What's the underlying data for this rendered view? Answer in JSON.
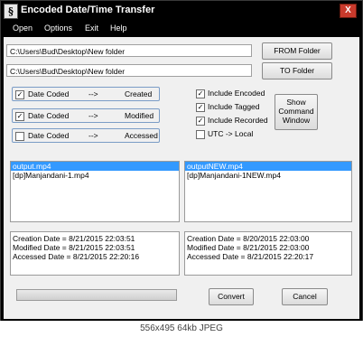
{
  "window": {
    "title": "Encoded Date/Time Transfer",
    "app_icon_glyph": "§",
    "close_glyph": "X"
  },
  "menu": [
    "Open",
    "Options",
    "Exit",
    "Help"
  ],
  "paths": {
    "from_folder": "C:\\Users\\Bud\\Desktop\\New folder",
    "to_folder": "C:\\Users\\Bud\\Desktop\\New folder"
  },
  "buttons": {
    "from_folder": "FROM Folder",
    "to_folder": "TO Folder",
    "show_cmd_1": "Show",
    "show_cmd_2": "Command",
    "show_cmd_3": "Window",
    "convert": "Convert",
    "cancel": "Cancel"
  },
  "mappings": [
    {
      "source": "Date Coded",
      "arrow": "-->",
      "target": "Created",
      "checked": true
    },
    {
      "source": "Date Coded",
      "arrow": "-->",
      "target": "Modified",
      "checked": true
    },
    {
      "source": "Date Coded",
      "arrow": "-->",
      "target": "Accessed",
      "checked": false
    }
  ],
  "options": [
    {
      "label": "Include Encoded",
      "checked": true
    },
    {
      "label": "Include Tagged",
      "checked": true
    },
    {
      "label": "Include Recorded",
      "checked": true
    },
    {
      "label": "UTC -> Local",
      "checked": false
    }
  ],
  "left_list": {
    "items": [
      "output.mp4",
      "[dp]Manjandani-1.mp4"
    ],
    "selected_index": 0
  },
  "right_list": {
    "items": [
      "outputNEW.mp4",
      "[dp]Manjandani-1NEW.mp4"
    ],
    "selected_index": 0
  },
  "left_info": [
    "Creation Date = 8/21/2015 22:03:51",
    "Modified Date = 8/21/2015 22:03:51",
    "Accessed Date = 8/21/2015 22:20:16"
  ],
  "right_info": [
    "Creation Date = 8/20/2015 22:03:00",
    "Modified Date = 8/21/2015 22:03:00",
    "Accessed Date = 8/21/2015 22:20:17"
  ],
  "progress": {
    "value": 0
  },
  "image_caption": "556x495 64kb JPEG",
  "colors": {
    "title_bar": "#000000",
    "selection": "#3399ff",
    "group_border": "#7a9cc6",
    "close": "#c93a2c"
  }
}
